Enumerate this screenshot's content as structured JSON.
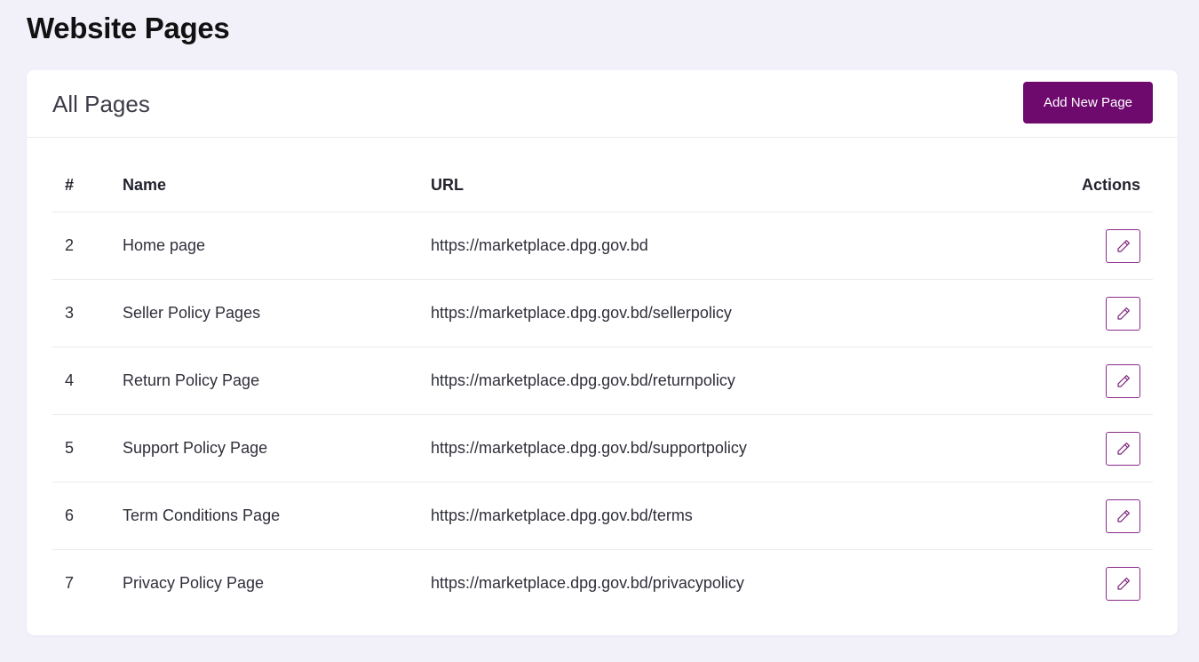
{
  "page": {
    "title": "Website Pages"
  },
  "card": {
    "title": "All Pages",
    "add_button_label": "Add New Page"
  },
  "table": {
    "columns": {
      "num": "#",
      "name": "Name",
      "url": "URL",
      "actions": "Actions"
    },
    "rows": [
      {
        "num": "2",
        "name": "Home page",
        "url": "https://marketplace.dpg.gov.bd"
      },
      {
        "num": "3",
        "name": "Seller Policy Pages",
        "url": "https://marketplace.dpg.gov.bd/sellerpolicy"
      },
      {
        "num": "4",
        "name": "Return Policy Page",
        "url": "https://marketplace.dpg.gov.bd/returnpolicy"
      },
      {
        "num": "5",
        "name": "Support Policy Page",
        "url": "https://marketplace.dpg.gov.bd/supportpolicy"
      },
      {
        "num": "6",
        "name": "Term Conditions Page",
        "url": "https://marketplace.dpg.gov.bd/terms"
      },
      {
        "num": "7",
        "name": "Privacy Policy Page",
        "url": "https://marketplace.dpg.gov.bd/privacypolicy"
      }
    ]
  },
  "icons": {
    "edit": "pencil-icon"
  },
  "colors": {
    "accent": "#6e0a6e",
    "background": "#f2f0f9",
    "edit_border": "#8b2a8b"
  }
}
